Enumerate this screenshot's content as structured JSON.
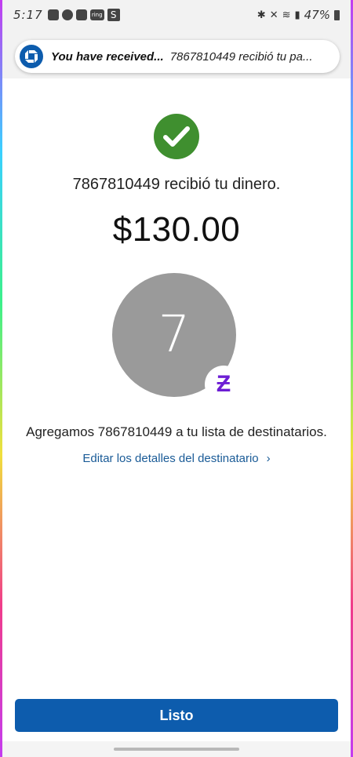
{
  "status_bar": {
    "time": "5:17",
    "battery": "47%",
    "app_icons": [
      "chat-icon",
      "pinterest-icon",
      "youtube-icon",
      "ring-icon",
      "s-icon"
    ],
    "ring_label": "ring",
    "s_label": "S"
  },
  "notification": {
    "title": "You have received...",
    "body": "7867810449 recibió tu pa..."
  },
  "main": {
    "received_text": "7867810449 recibió tu dinero.",
    "amount": "$130.00",
    "avatar_initial": "7",
    "badge_symbol": "Ƶ",
    "added_text": "Agregamos 7867810449 a tu lista de destinatarios.",
    "edit_link": "Editar los detalles del destinatario",
    "edit_chevron": "›"
  },
  "footer": {
    "done_label": "Listo"
  },
  "colors": {
    "accent": "#0d5cad",
    "success": "#3f8f2f",
    "zelle": "#6d1ed4",
    "link": "#1a5b97",
    "avatar": "#9a9a9a"
  }
}
